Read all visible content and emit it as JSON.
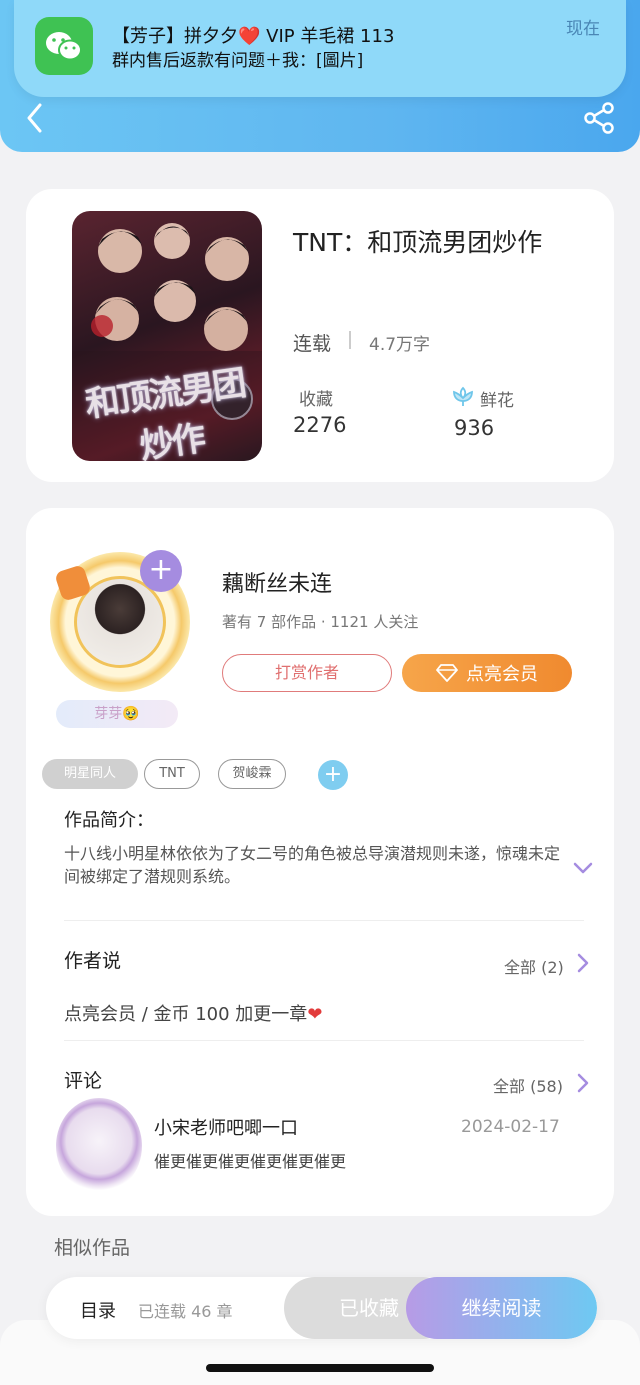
{
  "notification": {
    "title": "【芳子】拼夕夕❤️ VIP 羊毛裙 113",
    "body": "群内售后返款有问题＋我：[圖片]",
    "time": "现在",
    "app_icon": "wechat-icon"
  },
  "header": {
    "back_icon": "chevron-left-icon",
    "share_icon": "share-icon"
  },
  "book": {
    "title": "TNT：和顶流男团炒作",
    "status": "连载",
    "word_count": "4.7万字",
    "favorites_label": "收藏",
    "favorites_value": "2276",
    "flowers_label": "鲜花",
    "flowers_value": "936",
    "cover_text": "和顶流男团炒作"
  },
  "author": {
    "name": "藕断丝未连",
    "meta": "著有 7 部作品 · 1121 人关注",
    "tip_button": "打赏作者",
    "vip_button": "点亮会员",
    "nickname_badge": "芽芽🥹",
    "follow_icon": "plus-icon"
  },
  "tags": [
    "明星同人",
    "TNT",
    "贺峻霖"
  ],
  "synopsis": {
    "heading": "作品简介：",
    "text": "十八线小明星林依依为了女二号的角色被总导演潜规则未遂，惊魂未定间被绑定了潜规则系统。"
  },
  "author_says": {
    "heading": "作者说",
    "all_label": "全部 (2)",
    "text": "点亮会员 / 金币 100 加更一章"
  },
  "comments": {
    "heading": "评论",
    "all_label": "全部 (58)",
    "items": [
      {
        "user": "小宋老师吧唧一口",
        "date": "2024-02-17",
        "text": "催更催更催更催更催更催更"
      }
    ]
  },
  "similar": {
    "heading": "相似作品"
  },
  "bottom_bar": {
    "toc_label": "目录",
    "toc_count": "已连载 46 章",
    "collected_button": "已收藏",
    "read_button": "继续阅读"
  },
  "colors": {
    "header": "#5fb6f0",
    "vip_orange": "#f08a2f",
    "tip_red": "#e07070",
    "purple_accent": "#a58ce0",
    "read_gradient_start": "#b79be6",
    "read_gradient_end": "#6ec9f2"
  }
}
